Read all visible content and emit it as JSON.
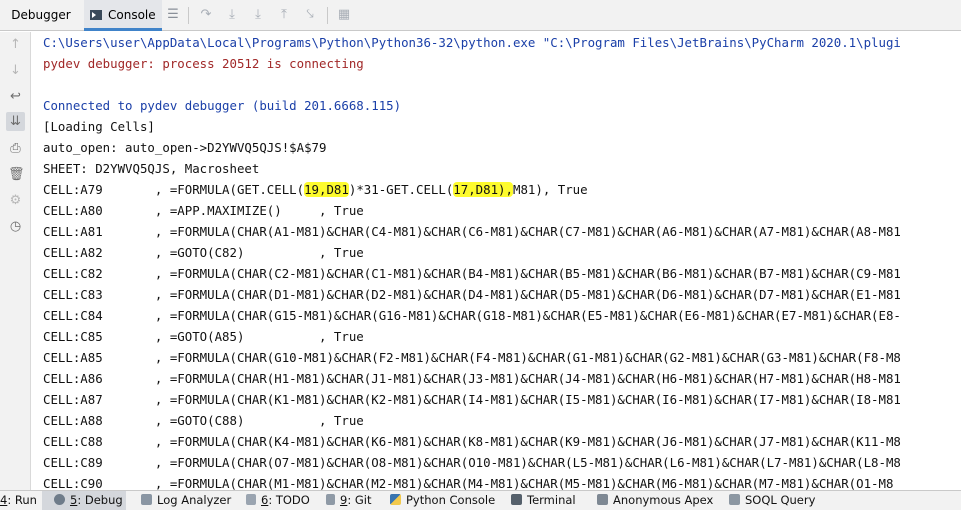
{
  "tabs": {
    "debugger": "Debugger",
    "console": "Console"
  },
  "console_lines": [
    {
      "text": "C:\\Users\\user\\AppData\\Local\\Programs\\Python\\Python36-32\\python.exe \"C:\\Program Files\\JetBrains\\PyCharm 2020.1\\plugi",
      "style": "blue"
    },
    {
      "text": "pydev debugger: process 20512 is connecting",
      "style": "red"
    },
    {
      "text": "",
      "style": "blk"
    },
    {
      "text": "Connected to pydev debugger (build 201.6668.115)",
      "style": "blue"
    },
    {
      "text": "[Loading Cells]",
      "style": "blk"
    },
    {
      "text": "auto_open: auto_open->D2YWVQ5QJS!$A$79",
      "style": "blk"
    },
    {
      "text": "SHEET: D2YWVQ5QJS, Macrosheet",
      "style": "blk"
    },
    {
      "segments": [
        "CELL:A79       , =FORMULA(GET.CELL(",
        "19,D81",
        ")*31-GET.CELL(",
        "17,D81),",
        "M81), True"
      ],
      "style": "blk"
    },
    {
      "text": "CELL:A80       , =APP.MAXIMIZE()     , True",
      "style": "blk"
    },
    {
      "text": "CELL:A81       , =FORMULA(CHAR(A1-M81)&CHAR(C4-M81)&CHAR(C6-M81)&CHAR(C7-M81)&CHAR(A6-M81)&CHAR(A7-M81)&CHAR(A8-M81",
      "style": "blk"
    },
    {
      "text": "CELL:A82       , =GOTO(C82)          , True",
      "style": "blk"
    },
    {
      "text": "CELL:C82       , =FORMULA(CHAR(C2-M81)&CHAR(C1-M81)&CHAR(B4-M81)&CHAR(B5-M81)&CHAR(B6-M81)&CHAR(B7-M81)&CHAR(C9-M81",
      "style": "blk"
    },
    {
      "text": "CELL:C83       , =FORMULA(CHAR(D1-M81)&CHAR(D2-M81)&CHAR(D4-M81)&CHAR(D5-M81)&CHAR(D6-M81)&CHAR(D7-M81)&CHAR(E1-M81",
      "style": "blk"
    },
    {
      "text": "CELL:C84       , =FORMULA(CHAR(G15-M81)&CHAR(G16-M81)&CHAR(G18-M81)&CHAR(E5-M81)&CHAR(E6-M81)&CHAR(E7-M81)&CHAR(E8-",
      "style": "blk"
    },
    {
      "text": "CELL:C85       , =GOTO(A85)          , True",
      "style": "blk"
    },
    {
      "text": "CELL:A85       , =FORMULA(CHAR(G10-M81)&CHAR(F2-M81)&CHAR(F4-M81)&CHAR(G1-M81)&CHAR(G2-M81)&CHAR(G3-M81)&CHAR(F8-M8",
      "style": "blk"
    },
    {
      "text": "CELL:A86       , =FORMULA(CHAR(H1-M81)&CHAR(J1-M81)&CHAR(J3-M81)&CHAR(J4-M81)&CHAR(H6-M81)&CHAR(H7-M81)&CHAR(H8-M81",
      "style": "blk"
    },
    {
      "text": "CELL:A87       , =FORMULA(CHAR(K1-M81)&CHAR(K2-M81)&CHAR(I4-M81)&CHAR(I5-M81)&CHAR(I6-M81)&CHAR(I7-M81)&CHAR(I8-M81",
      "style": "blk"
    },
    {
      "text": "CELL:A88       , =GOTO(C88)          , True",
      "style": "blk"
    },
    {
      "text": "CELL:C88       , =FORMULA(CHAR(K4-M81)&CHAR(K6-M81)&CHAR(K8-M81)&CHAR(K9-M81)&CHAR(J6-M81)&CHAR(J7-M81)&CHAR(K11-M8",
      "style": "blk"
    },
    {
      "text": "CELL:C89       , =FORMULA(CHAR(O7-M81)&CHAR(O8-M81)&CHAR(O10-M81)&CHAR(L5-M81)&CHAR(L6-M81)&CHAR(L7-M81)&CHAR(L8-M8",
      "style": "blk"
    },
    {
      "text": "CELL:C90       , =FORMULA(CHAR(M1-M81)&CHAR(M2-M81)&CHAR(M4-M81)&CHAR(M5-M81)&CHAR(M6-M81)&CHAR(M7-M81)&CHAR(O1-M8",
      "style": "blk"
    }
  ],
  "bottom_tabs": {
    "run_num": "4",
    "run": ": Run",
    "debug_num": "5",
    "debug": ": Debug",
    "log_analyzer": "Log Analyzer",
    "todo_num": "6",
    "todo": ": TODO",
    "git_num": "9",
    "git": ": Git",
    "python_console": "Python Console",
    "terminal": "Terminal",
    "anonymous_apex": "Anonymous Apex",
    "soql_query": "SOQL Query"
  },
  "colors": {
    "highlight": "#fdfb2d",
    "path_blue": "#1a3fa8",
    "connect_red": "#a12828"
  }
}
